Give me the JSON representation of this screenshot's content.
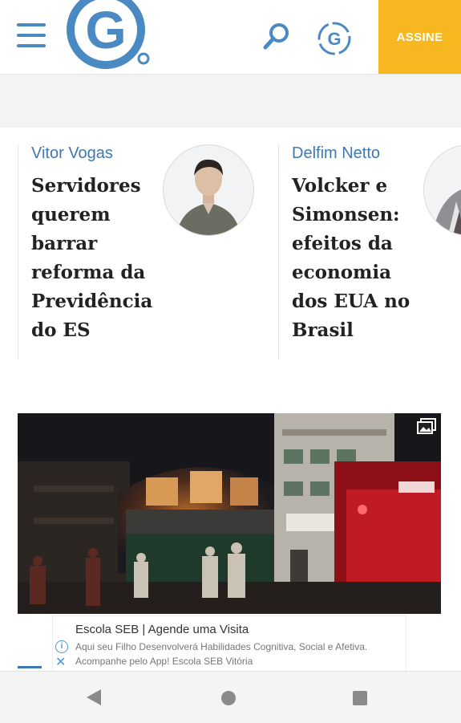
{
  "header": {
    "logo_letter": "G",
    "subscribe_label": "ASSINE",
    "icons": [
      "menu-icon",
      "search-icon",
      "g-circle-icon"
    ],
    "brand_blue": "#4a89c1",
    "accent_yellow": "#f7b721"
  },
  "columns": [
    {
      "author": "Vitor Vogas",
      "title": "Servidores querem barrar reforma da Previdência do ES"
    },
    {
      "author": "Delfim Netto",
      "title": "Volcker e Simonsen: efeitos da economia dos EUA no Brasil"
    }
  ],
  "photo": {
    "icon": "gallery-icon"
  },
  "ad": {
    "title": "Escola SEB | Agende uma Visita",
    "text": "Aqui seu Filho Desenvolverá Habilidades Cognitiva, Social e Afetiva. Acompanhe pelo App! Escola SEB Vitória"
  },
  "navbar": {
    "icons": [
      "back-icon",
      "home-icon",
      "recents-icon"
    ]
  }
}
